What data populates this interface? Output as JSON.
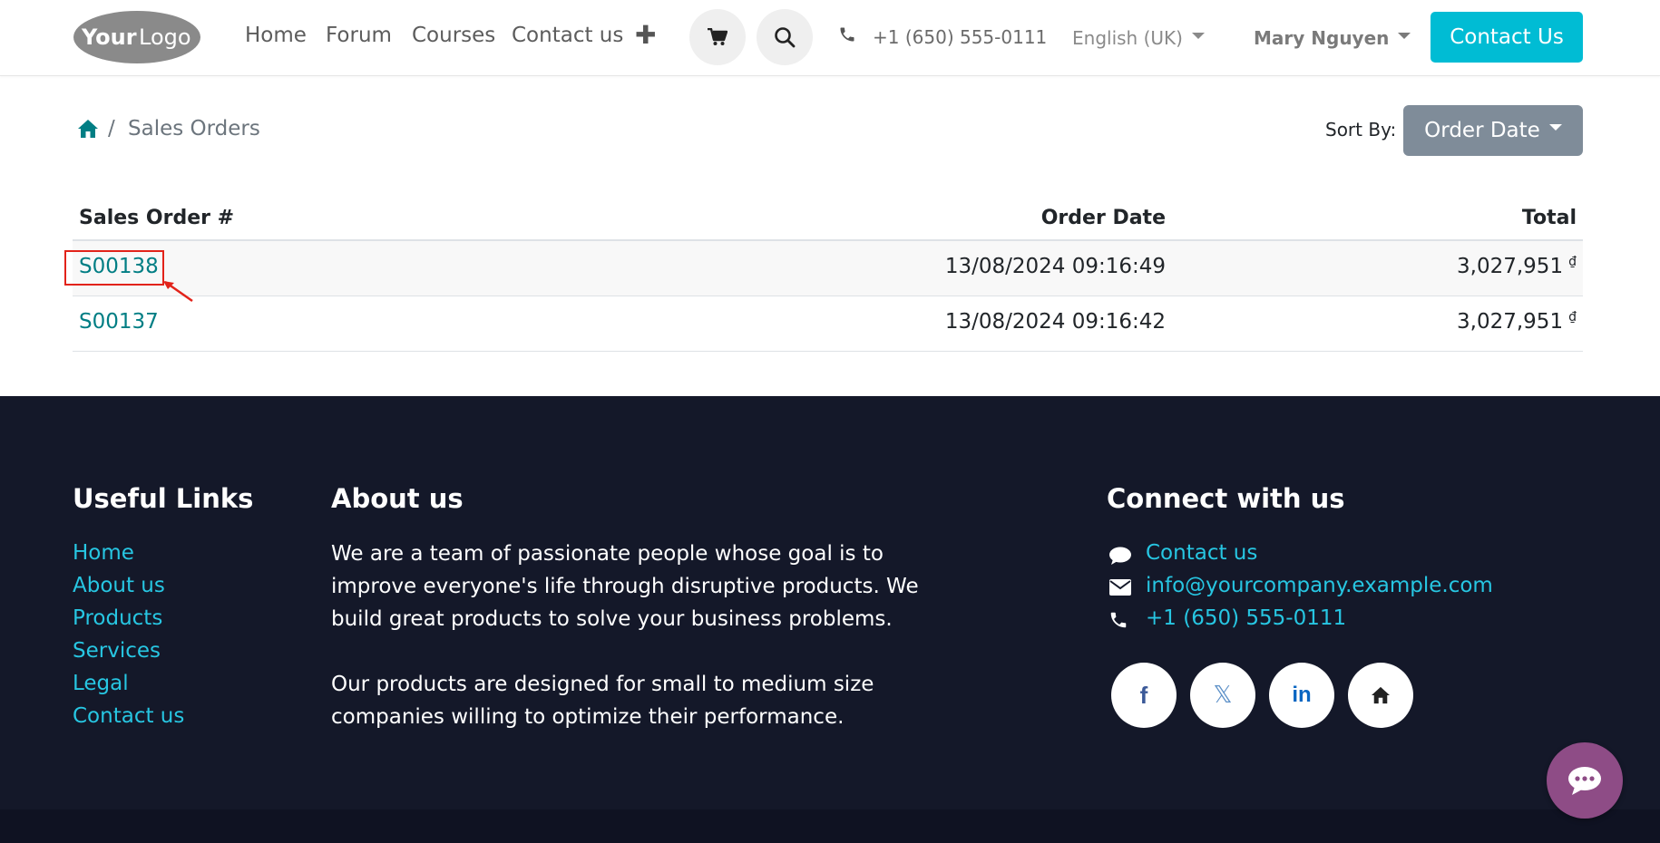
{
  "header": {
    "logo": {
      "text_your": "Your",
      "text_logo": "Logo"
    },
    "nav": [
      {
        "label": "Home"
      },
      {
        "label": "Forum"
      },
      {
        "label": "Courses"
      },
      {
        "label": "Contact us"
      }
    ],
    "phone": "+1 (650) 555-0111",
    "language": "English (UK)",
    "user": "Mary Nguyen",
    "cta_label": "Contact Us",
    "icons": {
      "add": "plus-icon",
      "cart": "cart-icon",
      "search": "search-icon",
      "phone": "phone-icon"
    }
  },
  "breadcrumb": {
    "home_icon": "home-icon",
    "separator": "/",
    "current": "Sales Orders"
  },
  "sort": {
    "label": "Sort By:",
    "selected": "Order Date"
  },
  "table": {
    "columns": [
      "Sales Order #",
      "Order Date",
      "Total"
    ],
    "rows": [
      {
        "order": "S00138",
        "date": "13/08/2024  09:16:49",
        "total": "3,027,951",
        "currency": "₫",
        "highlighted": true
      },
      {
        "order": "S00137",
        "date": "13/08/2024  09:16:42",
        "total": "3,027,951",
        "currency": "₫",
        "highlighted": false
      }
    ]
  },
  "footer": {
    "useful_links": {
      "heading": "Useful Links",
      "links": [
        "Home",
        "About us",
        "Products",
        "Services",
        "Legal",
        "Contact us"
      ]
    },
    "about": {
      "heading": "About us",
      "paragraphs": [
        "We are a team of passionate people whose goal is to improve everyone's life through disruptive products. We build great products to solve your business problems.",
        "Our products are designed for small to medium size companies willing to optimize their performance."
      ]
    },
    "connect": {
      "heading": "Connect with us",
      "items": [
        {
          "icon": "comment-icon",
          "label": "Contact us"
        },
        {
          "icon": "envelope-icon",
          "label": "info@yourcompany.example.com"
        },
        {
          "icon": "phone-icon",
          "label": "+1 (650) 555-0111"
        }
      ],
      "social": [
        {
          "icon": "facebook-icon",
          "glyph": "f"
        },
        {
          "icon": "x-twitter-icon",
          "glyph": "𝕏"
        },
        {
          "icon": "linkedin-icon",
          "glyph": "in"
        },
        {
          "icon": "home-icon",
          "glyph": ""
        }
      ]
    }
  },
  "colors": {
    "accent": "#00bcd4",
    "link": "#017e84",
    "footer_bg": "#141829",
    "footer_link": "#27c6e2",
    "sort_btn": "#7f8c99",
    "chat": "#8e4c86",
    "highlight": "#e2231a"
  }
}
